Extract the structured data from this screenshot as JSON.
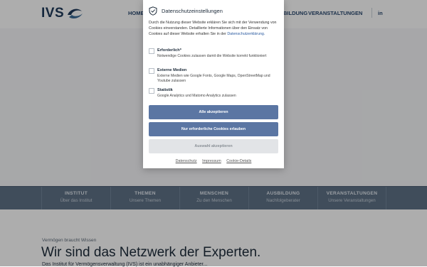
{
  "site": {
    "logo_text": "IVS",
    "nav": {
      "home": "HOME",
      "bildung": "BILDUNG",
      "veranstaltungen": "VERANSTALTUNGEN",
      "linkedin": "in"
    }
  },
  "band": {
    "items": [
      {
        "title": "INSTITUT",
        "sub": "Über das Institut"
      },
      {
        "title": "THEMEN",
        "sub": "Unsere Themen"
      },
      {
        "title": "MENSCHEN",
        "sub": "Zu den Menschen"
      },
      {
        "title": "AUSBILDUNG",
        "sub": "Nachfolgeberater"
      },
      {
        "title": "VERANSTALTUNGEN",
        "sub": "Unsere Veranstaltungen"
      }
    ]
  },
  "content": {
    "kicker": "Vermögen braucht Wissen",
    "headline": "Wir sind das Netzwerk der Experten.",
    "body": "Das Institut für Vermögensverwaltung (IVS) ist ein unabhängiger Anbieter..."
  },
  "cookie": {
    "title": "Datenschutzeinstellungen",
    "intro": "Durch die Nutzung dieser Website erklären Sie sich mit der Verwendung von Cookies einverstanden. Detaillierte Informationen über den Einsatz von Cookies auf dieser Website erhalten Sie in der",
    "intro_link": "Datenschutzerklärung.",
    "options": [
      {
        "label": "Erforderlich*",
        "desc": "Notwendige Cookies zulassen damit die Website korrekt funktioniert"
      },
      {
        "label": "Externe Medien",
        "desc": "Externe Medien wie Google Fonts, Google Maps, OpenStreetMap und Youtube zulassen"
      },
      {
        "label": "Statistik",
        "desc": "Google Analytics und Matomo Analytics zulassen"
      }
    ],
    "buttons": {
      "accept_all": "Alle akzeptieren",
      "required_only": "Nur erforderliche Cookies erlauben",
      "accept_selection": "Auswahl akzeptieren"
    },
    "footer": {
      "datenschutz": "Datenschutz",
      "impressum": "Impressum",
      "details": "Cookie-Details"
    }
  },
  "colors": {
    "primary_button": "#5b76a3",
    "band": "#5f7287",
    "logo": "#1f3a5a"
  },
  "icons": {
    "modal": "shield-check-icon",
    "logo": "wave-logo-icon"
  }
}
